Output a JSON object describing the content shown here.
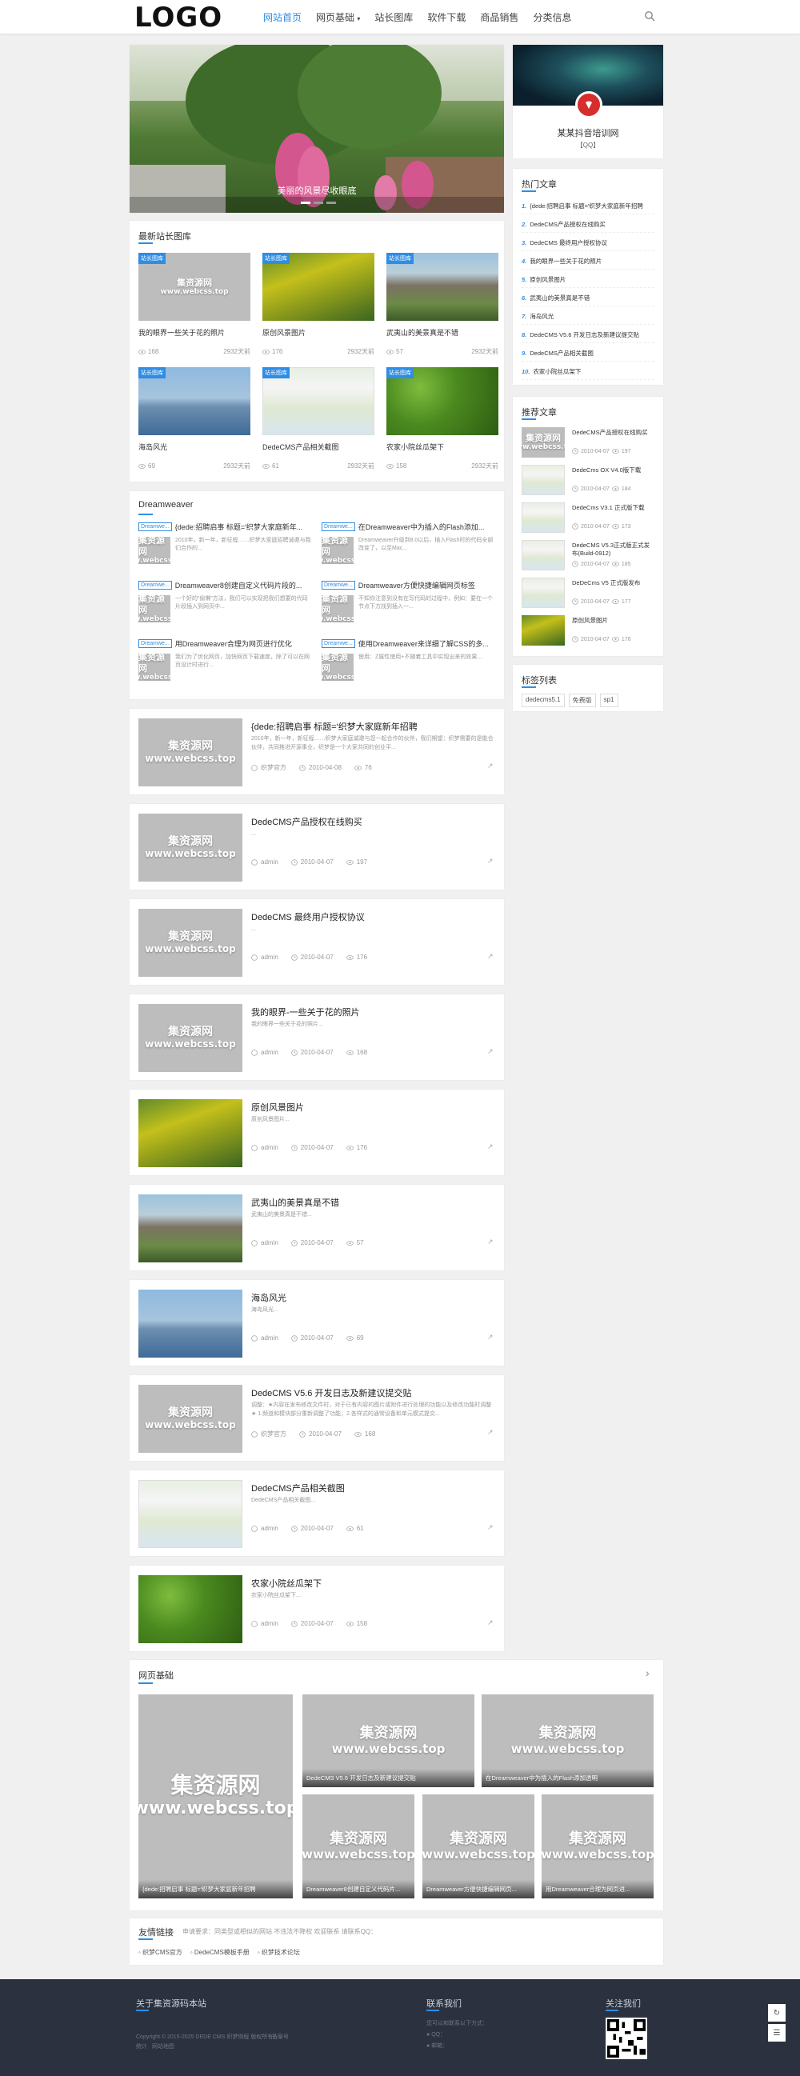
{
  "header": {
    "logo": "LOGO",
    "nav": [
      "网站首页",
      "网页基础",
      "站长图库",
      "软件下载",
      "商品销售",
      "分类信息"
    ]
  },
  "slider": {
    "caption": "美丽的风景尽收眼底"
  },
  "profile": {
    "name": "某某抖音培训网",
    "qq": "【QQ】"
  },
  "gallery": {
    "title": "最新站长图库",
    "badge": "站长图库",
    "items": [
      {
        "title": "我的眼界一些关于花的照片",
        "views": "168",
        "date": "2932天前"
      },
      {
        "title": "原创风景图片",
        "views": "176",
        "date": "2932天前"
      },
      {
        "title": "武夷山的美景真是不错",
        "views": "57",
        "date": "2932天前"
      },
      {
        "title": "海岛风光",
        "views": "69",
        "date": "2932天前"
      },
      {
        "title": "DedeCMS产品相关截图",
        "views": "61",
        "date": "2932天前"
      },
      {
        "title": "农家小院丝瓜架下",
        "views": "158",
        "date": "2932天前"
      }
    ]
  },
  "placeholder": {
    "big": "集资源网",
    "small": "www.webcss.top"
  },
  "dw": {
    "title": "Dreamweaver",
    "tag": "Dreamwe...",
    "items": [
      {
        "title": "{dede:招聘启事 标题='织梦大家庭新年...",
        "desc": "2010年，新一年，新征程……织梦大家庭招聘诚邀与我们合作的..."
      },
      {
        "title": "在Dreamweaver中为插入的Flash添加...",
        "desc": "Dreamweaver升级到8.0以后，插入Flash时的代码全部改变了，以至Mac..."
      },
      {
        "title": "Dreamweaver8创建自定义代码片段的...",
        "desc": "一个好的“偷懒”方法，我们可以实现把我们想要的代码片段插入到网页中..."
      },
      {
        "title": "Dreamweaver方便快捷编辑网页标签",
        "desc": "不知你注意到没有在写代码的过程中，例如：要在一个节点下方找到插入一..."
      },
      {
        "title": "用Dreamweaver合理为网页进行优化",
        "desc": "我们为了优化网页，加快网页下载速度，除了可以在网页设计时进行..."
      },
      {
        "title": "使用Dreamweaver来详细了解CSS的多...",
        "desc": "使用：Z属性使用+不随着工具中实现出来的效果..."
      }
    ]
  },
  "articles": [
    {
      "title": "{dede:招聘启事 标题='织梦大家庭新年招聘",
      "excerpt": "2010年，新一年，新征程……织梦大家庭诚邀与您一起合作的伙伴，我们期望：织梦需要的是能合伙伴，共同推进开源事业，织梦是一个大家共同的创业平...",
      "author": "织梦官方",
      "date": "2010-04-08",
      "views": "76",
      "img": "ph"
    },
    {
      "title": "DedeCMS产品授权在线购买",
      "excerpt": "...",
      "author": "admin",
      "date": "2010-04-07",
      "views": "197",
      "img": "ph"
    },
    {
      "title": "DedeCMS 最终用户授权协议",
      "excerpt": "...",
      "author": "admin",
      "date": "2010-04-07",
      "views": "176",
      "img": "ph"
    },
    {
      "title": "我的眼界-一些关于花的照片",
      "excerpt": "我的眼界一些关于花的照片...",
      "author": "admin",
      "date": "2010-04-07",
      "views": "168",
      "img": "ph"
    },
    {
      "title": "原创风景图片",
      "excerpt": "原创风景图片...",
      "author": "admin",
      "date": "2010-04-07",
      "views": "176",
      "img": "flower"
    },
    {
      "title": "武夷山的美景真是不错",
      "excerpt": "武夷山的美景真是不错...",
      "author": "admin",
      "date": "2010-04-07",
      "views": "57",
      "img": "mountain"
    },
    {
      "title": "海岛风光",
      "excerpt": "海岛风光...",
      "author": "admin",
      "date": "2010-04-07",
      "views": "69",
      "img": "sea"
    },
    {
      "title": "DedeCMS V5.6 开发日志及新建议提交贴",
      "excerpt": "调整：★内容在发布修改文件时，对于已有内容的图片或附件进行处理的功能以及修改功能时调整 ★ 1.频道和模块部分重新调整了功能；2.各样式的通常设备和单元模式提交...",
      "author": "织梦官方",
      "date": "2010-04-07",
      "views": "168",
      "img": "ph"
    },
    {
      "title": "DedeCMS产品相关截图",
      "excerpt": "DedeCMS产品相关截图...",
      "author": "admin",
      "date": "2010-04-07",
      "views": "61",
      "img": "screen"
    },
    {
      "title": "农家小院丝瓜架下",
      "excerpt": "农家小院丝瓜架下...",
      "author": "admin",
      "date": "2010-04-07",
      "views": "158",
      "img": "leaves"
    }
  ],
  "hot": {
    "title": "热门文章",
    "items": [
      "{dede:招聘启事 标题='织梦大家庭新年招聘",
      "DedeCMS产品授权在线购买",
      "DedeCMS 最终用户授权协议",
      "我的眼界一些关于花的照片",
      "原创风景图片",
      "武夷山的美景真是不错",
      "海岛风光",
      "DedeCMS V5.6 开发日志及新建议提交贴",
      "DedeCMS产品相关截图",
      "农家小院丝瓜架下"
    ]
  },
  "recommend": {
    "title": "推荐文章",
    "items": [
      {
        "title": "DedeCMS产品授权在线购买",
        "date": "2010-04-07",
        "views": "197",
        "img": "ph"
      },
      {
        "title": "DedeCms OX V4.0版下载",
        "date": "2010-04-07",
        "views": "184",
        "img": "screen"
      },
      {
        "title": "DedeCms V3.1 正式版下载",
        "date": "2010-04-07",
        "views": "173",
        "img": "screen"
      },
      {
        "title": "DedeCMS V5.3正式版正式发布(Build-0912)",
        "date": "2010-04-07",
        "views": "185",
        "img": "screen"
      },
      {
        "title": "DeDeCms V5 正式版发布",
        "date": "2010-04-07",
        "views": "177",
        "img": "screen"
      },
      {
        "title": "原创风景图片",
        "date": "2010-04-07",
        "views": "176",
        "img": "flower"
      }
    ]
  },
  "tags": {
    "title": "标签列表",
    "items": [
      "dedecms5.1",
      "免费版",
      "sp1"
    ]
  },
  "webbasics": {
    "title": "网页基础",
    "items": [
      "{dede:招聘启事 标题='织梦大家庭新年招聘",
      "DedeCMS V5.6 开发日志及新建议提交贴",
      "在Dreamweaver中为插入的Flash添加透明",
      "Dreamweaver8创建自定义代码片...",
      "Dreamweaver方便快捷编辑网页...",
      "用Dreamweaver合理为网页进..."
    ]
  },
  "links": {
    "title": "友情链接",
    "note": "申请要求：同类型或相似的网站 不违法不降权 欢迎联系 请联系QQ：",
    "items": [
      "织梦CMS官方",
      "DedeCMS模板手册",
      "织梦技术论坛"
    ]
  },
  "footer": {
    "about_title": "关于集资源码本站",
    "copyright": "Copyright © 2015-2025 DEDE CMS 织梦例程 版权所有",
    "record": "备案号",
    "stats": "统计",
    "sitemap": "网站地图",
    "contact_title": "联系我们",
    "contact_desc": "您可以和联系以下方式：",
    "qq": "QQ：",
    "email": "邮箱：",
    "follow_title": "关注我们"
  }
}
